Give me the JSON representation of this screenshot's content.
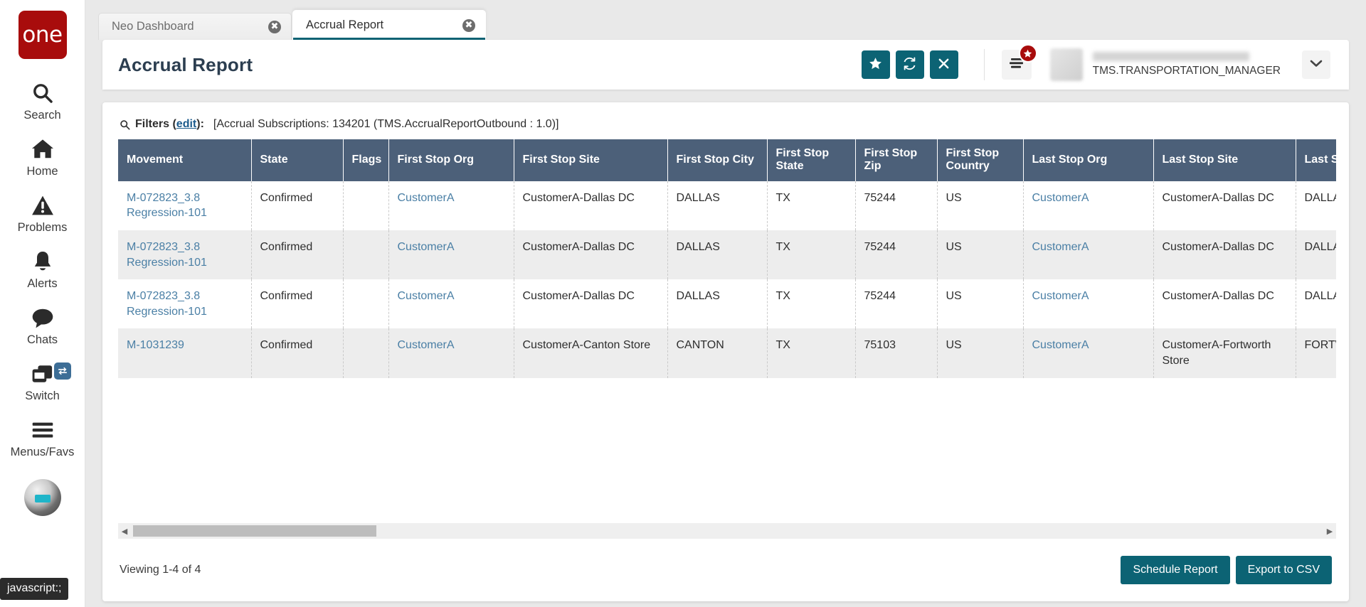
{
  "brand": {
    "logo_text": "one"
  },
  "sidebar": {
    "items": [
      {
        "label": "Search",
        "icon": "search-icon"
      },
      {
        "label": "Home",
        "icon": "home-icon"
      },
      {
        "label": "Problems",
        "icon": "warning-icon"
      },
      {
        "label": "Alerts",
        "icon": "bell-icon"
      },
      {
        "label": "Chats",
        "icon": "chat-icon"
      },
      {
        "label": "Switch",
        "icon": "switch-icon"
      },
      {
        "label": "Menus/Favs",
        "icon": "hamburger-icon"
      }
    ],
    "status_tooltip": "javascript:;"
  },
  "tabs": [
    {
      "label": "Neo Dashboard",
      "active": false,
      "close": "✖"
    },
    {
      "label": "Accrual Report",
      "active": true,
      "close": "✖"
    }
  ],
  "header": {
    "title": "Accrual Report",
    "actions": [
      {
        "name": "favorite-button",
        "icon": "star-icon",
        "glyph": "★"
      },
      {
        "name": "refresh-button",
        "icon": "refresh-icon",
        "glyph": "⟳"
      },
      {
        "name": "close-button",
        "icon": "close-icon",
        "glyph": "✕"
      }
    ],
    "menu_badge": "★",
    "user_role": "TMS.TRANSPORTATION_MANAGER",
    "caret": "⌄"
  },
  "filters": {
    "icon": "search-icon",
    "label": "Filters (",
    "edit_link": "edit",
    "label_end": "):",
    "value": "[Accrual Subscriptions: 134201 (TMS.AccrualReportOutbound : 1.0)]"
  },
  "table": {
    "columns": [
      "Movement",
      "State",
      "Flags",
      "First Stop Org",
      "First Stop Site",
      "First Stop City",
      "First Stop State",
      "First Stop Zip",
      "First Stop Country",
      "Last Stop Org",
      "Last Stop Site",
      "Last Stop"
    ],
    "rows": [
      {
        "movement": "M-072823_3.8 Regression-101",
        "state": "Confirmed",
        "flags": "",
        "first_stop_org": "CustomerA",
        "first_stop_site": "CustomerA-Dallas DC",
        "first_stop_city": "DALLAS",
        "first_stop_state": "TX",
        "first_stop_zip": "75244",
        "first_stop_country": "US",
        "last_stop_org": "CustomerA",
        "last_stop_site": "CustomerA-Dallas DC",
        "last_stop": "DALLAS"
      },
      {
        "movement": "M-072823_3.8 Regression-101",
        "state": "Confirmed",
        "flags": "",
        "first_stop_org": "CustomerA",
        "first_stop_site": "CustomerA-Dallas DC",
        "first_stop_city": "DALLAS",
        "first_stop_state": "TX",
        "first_stop_zip": "75244",
        "first_stop_country": "US",
        "last_stop_org": "CustomerA",
        "last_stop_site": "CustomerA-Dallas DC",
        "last_stop": "DALLAS"
      },
      {
        "movement": "M-072823_3.8 Regression-101",
        "state": "Confirmed",
        "flags": "",
        "first_stop_org": "CustomerA",
        "first_stop_site": "CustomerA-Dallas DC",
        "first_stop_city": "DALLAS",
        "first_stop_state": "TX",
        "first_stop_zip": "75244",
        "first_stop_country": "US",
        "last_stop_org": "CustomerA",
        "last_stop_site": "CustomerA-Dallas DC",
        "last_stop": "DALLAS"
      },
      {
        "movement": "M-1031239",
        "state": "Confirmed",
        "flags": "",
        "first_stop_org": "CustomerA",
        "first_stop_site": "CustomerA-Canton Store",
        "first_stop_city": "CANTON",
        "first_stop_state": "TX",
        "first_stop_zip": "75103",
        "first_stop_country": "US",
        "last_stop_org": "CustomerA",
        "last_stop_site": "CustomerA-Fortworth Store",
        "last_stop": "FORTWO"
      }
    ]
  },
  "footer": {
    "viewing": "Viewing 1-4 of 4",
    "schedule_label": "Schedule Report",
    "export_label": "Export to CSV"
  },
  "scrollbar": {
    "left_arrow": "◀",
    "right_arrow": "▶"
  },
  "colors": {
    "brand_red": "#a80c0c",
    "accent_teal": "#0c6374",
    "table_header": "#4c6079",
    "link_blue": "#4a7fa5"
  }
}
